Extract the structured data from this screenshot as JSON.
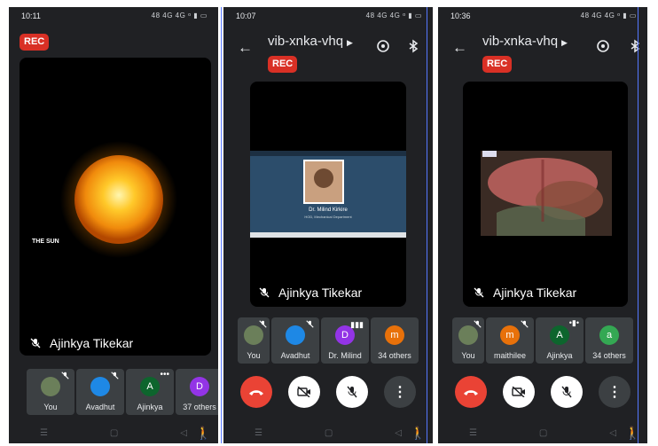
{
  "panels": [
    {
      "time": "10:11",
      "status_icons": "48 4G 4G ᵒ ▮ ▭",
      "rec": "REC",
      "meeting_code": "",
      "stage_caption": "THE SUN",
      "speaker": "Ajinkya Tikekar",
      "tiles": [
        {
          "label": "You",
          "avatar_color": "#6b7f5a",
          "initial": ""
        },
        {
          "label": "Avadhut",
          "avatar_color": "#1e88e5",
          "initial": ""
        },
        {
          "label": "Ajinkya",
          "avatar_color": "#0d652d",
          "initial": "A"
        },
        {
          "label": "37 others",
          "avatar_color": "#9334e6",
          "initial": "D"
        }
      ]
    },
    {
      "time": "10:07",
      "status_icons": "48 4G 4G ᵒ ▮ ▭",
      "rec": "REC",
      "meeting_code": "vib-xnka-vhq",
      "slide_name": "Dr. Milind Kirkire",
      "slide_sub": "HOD, Mechanical Department",
      "speaker": "Ajinkya Tikekar",
      "tiles": [
        {
          "label": "You",
          "avatar_color": "#6b7f5a",
          "initial": ""
        },
        {
          "label": "Avadhut",
          "avatar_color": "#1e88e5",
          "initial": ""
        },
        {
          "label": "Dr. Milind",
          "avatar_color": "#9334e6",
          "initial": "D"
        },
        {
          "label": "34 others",
          "avatar_color": "#e8710a",
          "initial": "m"
        }
      ]
    },
    {
      "time": "10:36",
      "status_icons": "48 4G 4G ᵒ ▮ ▭",
      "rec": "REC",
      "meeting_code": "vib-xnka-vhq",
      "speaker": "Ajinkya Tikekar",
      "tiles": [
        {
          "label": "You",
          "avatar_color": "#6b7f5a",
          "initial": ""
        },
        {
          "label": "maithilee",
          "avatar_color": "#e8710a",
          "initial": "m"
        },
        {
          "label": "Ajinkya",
          "avatar_color": "#0d652d",
          "initial": "A"
        },
        {
          "label": "34 others",
          "avatar_color": "#34a853",
          "initial": "a"
        }
      ]
    }
  ],
  "colors": {
    "rec": "#d93025",
    "end_call": "#ea4335",
    "tile": "#3c4043",
    "bg": "#202124"
  },
  "icons": [
    "back-arrow-icon",
    "flip-camera-icon",
    "bluetooth-icon",
    "mic-off-icon",
    "video-off-icon",
    "end-call-icon",
    "more-vert-icon"
  ]
}
